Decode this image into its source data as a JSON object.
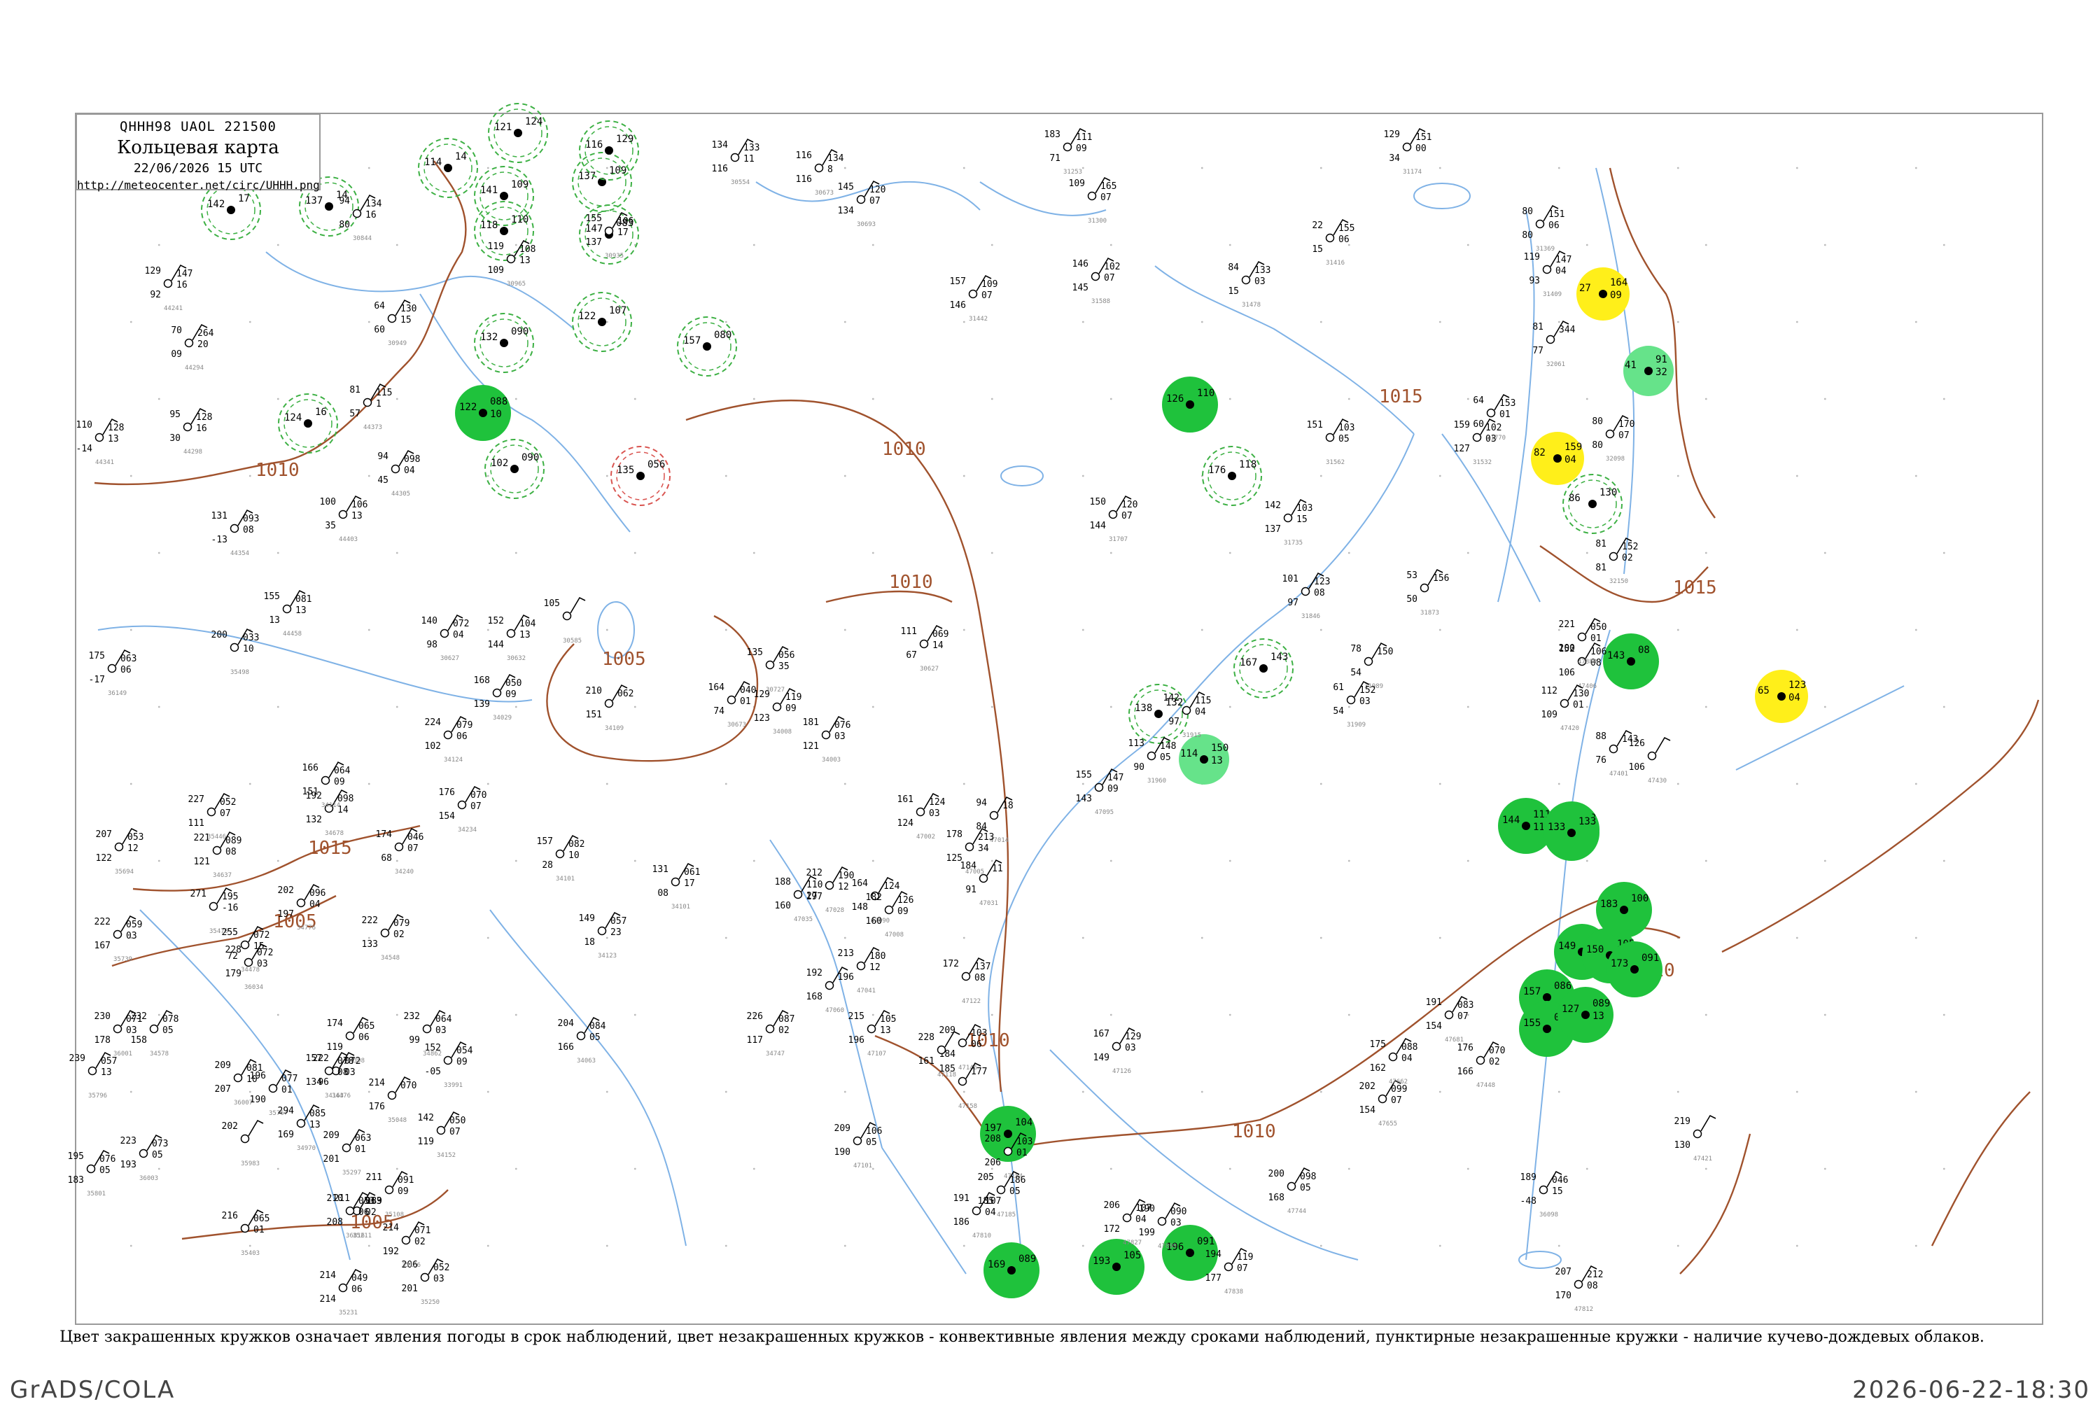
{
  "header": {
    "code": "QHHH98  UAOL  221500",
    "title": "Кольцевая карта",
    "date": "22/06/2026 15 UTC",
    "url": "http://meteocenter.net/circ/UHHH.png"
  },
  "caption": "Цвет закрашенных кружков означает явления погоды в срок наблюдений, цвет незакрашенных кружков - конвективные явления между сроками наблюдений, пунктирные незакрашенные кружки - наличие кучево-дождевых облаков.",
  "footer": {
    "left": "GrADS/COLA",
    "right": "2026-06-22-18:30"
  },
  "colors": {
    "frame": "#9a9a9a",
    "isobar": "#a0522d",
    "river": "#7fb2e6",
    "dashed_circle": "#3cb043",
    "green_fill": "#1fc23c",
    "light_green_fill": "#66e38a",
    "yellow_fill": "#ffef1a",
    "red_circle": "#d9534f"
  },
  "isobars": [
    {
      "label": "1010"
    },
    {
      "label": "1010"
    },
    {
      "label": "1005"
    },
    {
      "label": "1015"
    },
    {
      "label": "1005"
    },
    {
      "label": "1010"
    },
    {
      "label": "1005"
    },
    {
      "label": "1010"
    },
    {
      "label": "1010"
    },
    {
      "label": "1015"
    },
    {
      "label": "1015"
    },
    {
      "label": "1010"
    }
  ],
  "stations": [
    {
      "idx": "44241",
      "t": "129",
      "td": "92",
      "p": "147",
      "pt": "16"
    },
    {
      "idx": "44294",
      "t": "70",
      "td": "09",
      "p": "264",
      "pt": "20"
    },
    {
      "idx": "44298",
      "t": "95",
      "td": "30",
      "p": "128",
      "pt": "16"
    },
    {
      "idx": "44341",
      "t": "110",
      "td": "-14",
      "p": "128",
      "pt": "13"
    },
    {
      "idx": "44354",
      "t": "131",
      "td": "-13",
      "p": "093",
      "pt": "08"
    },
    {
      "idx": "44458",
      "t": "155",
      "td": "13",
      "p": "081",
      "pt": "13"
    },
    {
      "idx": "44403",
      "t": "100",
      "td": "35",
      "p": "106",
      "pt": "13"
    },
    {
      "idx": "44373",
      "t": "81",
      "td": "57",
      "p": "115",
      "pt": "1"
    },
    {
      "idx": "44305",
      "t": "94",
      "td": "45",
      "p": "098",
      "pt": "04"
    },
    {
      "idx": "30949",
      "t": "64",
      "td": "60",
      "p": "130",
      "pt": "15"
    },
    {
      "idx": "30844",
      "t": "94",
      "td": "80",
      "p": "134",
      "pt": "16"
    },
    {
      "idx": "30965",
      "t": "119",
      "td": "109",
      "p": "108",
      "pt": "13"
    },
    {
      "idx": "30935",
      "t": "155",
      "td": "137",
      "p": "106",
      "pt": "17"
    },
    {
      "idx": "30554",
      "t": "134",
      "td": "116",
      "p": "133",
      "pt": "11"
    },
    {
      "idx": "30673",
      "t": "116",
      "td": "116",
      "p": "134",
      "pt": "8"
    },
    {
      "idx": "30693",
      "t": "145",
      "td": "134",
      "p": "120",
      "pt": "07"
    },
    {
      "idx": "31253",
      "t": "183",
      "td": "71",
      "p": "111",
      "pt": "09"
    },
    {
      "idx": "31300",
      "t": "109",
      "td": "",
      "p": "165",
      "pt": "07"
    },
    {
      "idx": "31442",
      "t": "157",
      "td": "146",
      "p": "109",
      "pt": "07"
    },
    {
      "idx": "31588",
      "t": "146",
      "td": "145",
      "p": "102",
      "pt": "07"
    },
    {
      "idx": "31478",
      "t": "84",
      "td": "15",
      "p": "133",
      "pt": "03"
    },
    {
      "idx": "31416",
      "t": "22",
      "td": "15",
      "p": "155",
      "pt": "06"
    },
    {
      "idx": "31174",
      "t": "129",
      "td": "34",
      "p": "151",
      "pt": "00"
    },
    {
      "idx": "31409",
      "t": "119",
      "td": "93",
      "p": "147",
      "pt": "04"
    },
    {
      "idx": "31369",
      "t": "80",
      "td": "80",
      "p": "151",
      "pt": "06"
    },
    {
      "idx": "32061",
      "t": "81",
      "td": "77",
      "p": "344",
      "pt": ""
    },
    {
      "idx": "32098",
      "t": "80",
      "td": "80",
      "p": "170",
      "pt": "07"
    },
    {
      "idx": "31770",
      "t": "64",
      "td": "60",
      "p": "153",
      "pt": "01"
    },
    {
      "idx": "32150",
      "t": "81",
      "td": "81",
      "p": "152",
      "pt": "02"
    },
    {
      "idx": "31735",
      "t": "142",
      "td": "137",
      "p": "103",
      "pt": "15"
    },
    {
      "idx": "31873",
      "t": "53",
      "td": "50",
      "p": "156",
      "pt": ""
    },
    {
      "idx": "31707",
      "t": "150",
      "td": "144",
      "p": "120",
      "pt": "07"
    },
    {
      "idx": "31562",
      "t": "151",
      "td": "",
      "p": "103",
      "pt": "05"
    },
    {
      "idx": "31532",
      "t": "159",
      "td": "127",
      "p": "102",
      "pt": "03"
    },
    {
      "idx": "31846",
      "t": "101",
      "td": "97",
      "p": "123",
      "pt": "08"
    },
    {
      "idx": "31989",
      "t": "78",
      "td": "54",
      "p": "150",
      "pt": ""
    },
    {
      "idx": "31909",
      "t": "61",
      "td": "54",
      "p": "152",
      "pt": "03"
    },
    {
      "idx": "31915",
      "t": "142",
      "td": "97",
      "p": "115",
      "pt": "04"
    },
    {
      "idx": "31960",
      "t": "113",
      "td": "90",
      "p": "148",
      "pt": "05"
    },
    {
      "idx": "47095",
      "t": "155",
      "td": "143",
      "p": "147",
      "pt": "09"
    },
    {
      "idx": "47014",
      "t": "94",
      "td": "84",
      "p": "18",
      "pt": ""
    },
    {
      "idx": "47002",
      "t": "161",
      "td": "124",
      "p": "124",
      "pt": "03"
    },
    {
      "idx": "47005",
      "t": "178",
      "td": "125",
      "p": "213",
      "pt": "34"
    },
    {
      "idx": "47028",
      "t": "212",
      "td": "197",
      "p": "190",
      "pt": "12"
    },
    {
      "idx": "47035",
      "t": "188",
      "td": "160",
      "p": "110",
      "pt": "27"
    },
    {
      "idx": "47090",
      "t": "164",
      "td": "148",
      "p": "124",
      "pt": ""
    },
    {
      "idx": "47031",
      "t": "184",
      "td": "91",
      "p": "11",
      "pt": ""
    },
    {
      "idx": "47008",
      "t": "182",
      "td": "160",
      "p": "126",
      "pt": "09"
    },
    {
      "idx": "47041",
      "t": "213",
      "td": "196",
      "p": "180",
      "pt": "12"
    },
    {
      "idx": "47060",
      "t": "192",
      "td": "168",
      "p": "",
      "pt": ""
    },
    {
      "idx": "47122",
      "t": "172",
      "td": "",
      "p": "137",
      "pt": "08"
    },
    {
      "idx": "47107",
      "t": "215",
      "td": "196",
      "p": "105",
      "pt": "13"
    },
    {
      "idx": "47146",
      "t": "209",
      "td": "184",
      "p": "103",
      "pt": "06"
    },
    {
      "idx": "47118",
      "t": "228",
      "td": "161",
      "p": "",
      "pt": ""
    },
    {
      "idx": "47126",
      "t": "167",
      "td": "149",
      "p": "129",
      "pt": "03"
    },
    {
      "idx": "47101",
      "t": "209",
      "td": "190",
      "p": "106",
      "pt": "05"
    },
    {
      "idx": "47158",
      "t": "185",
      "td": "",
      "p": "177",
      "pt": ""
    },
    {
      "idx": "47184",
      "t": "208",
      "td": "206",
      "p": "103",
      "pt": "01"
    },
    {
      "idx": "47185",
      "t": "205",
      "td": "185",
      "p": "186",
      "pt": "05"
    },
    {
      "idx": "47810",
      "t": "191",
      "td": "186",
      "p": "107",
      "pt": "04"
    },
    {
      "idx": "47827",
      "t": "206",
      "td": "172",
      "p": "107",
      "pt": "04"
    },
    {
      "idx": "47899",
      "t": "190",
      "td": "199",
      "p": "090",
      "pt": "03"
    },
    {
      "idx": "47838",
      "t": "194",
      "td": "177",
      "p": "119",
      "pt": "07"
    },
    {
      "idx": "47744",
      "t": "200",
      "td": "168",
      "p": "098",
      "pt": "05"
    },
    {
      "idx": "47655",
      "t": "202",
      "td": "154",
      "p": "099",
      "pt": "07"
    },
    {
      "idx": "47662",
      "t": "175",
      "td": "162",
      "p": "088",
      "pt": "04"
    },
    {
      "idx": "47681",
      "t": "191",
      "td": "154",
      "p": "083",
      "pt": "07"
    },
    {
      "idx": "47448",
      "t": "176",
      "td": "166",
      "p": "070",
      "pt": "02"
    },
    {
      "idx": "47421",
      "t": "219",
      "td": "130",
      "p": "",
      "pt": ""
    },
    {
      "idx": "47406",
      "t": "152",
      "td": "106",
      "p": "106",
      "pt": "08"
    },
    {
      "idx": "47420",
      "t": "112",
      "td": "109",
      "p": "130",
      "pt": "01"
    },
    {
      "idx": "47430",
      "t": "126",
      "td": "106",
      "p": "",
      "pt": ""
    },
    {
      "idx": "47401",
      "t": "88",
      "td": "76",
      "p": "143",
      "pt": ""
    },
    {
      "idx": "47880",
      "t": "221",
      "td": "200",
      "p": "050",
      "pt": "01"
    },
    {
      "idx": "47812",
      "t": "207",
      "td": "170",
      "p": "212",
      "pt": "08"
    },
    {
      "idx": "36098",
      "t": "189",
      "td": "-48",
      "p": "046",
      "pt": "15"
    },
    {
      "idx": "36149",
      "t": "175",
      "td": "-17",
      "p": "063",
      "pt": "06"
    },
    {
      "idx": "35498",
      "t": "200",
      "td": "",
      "p": "033",
      "pt": "10"
    },
    {
      "idx": "35446",
      "t": "227",
      "td": "111",
      "p": "052",
      "pt": "07"
    },
    {
      "idx": "35694",
      "t": "207",
      "td": "122",
      "p": "053",
      "pt": "12"
    },
    {
      "idx": "35470",
      "t": "271",
      "td": "",
      "p": "195",
      "pt": "-16"
    },
    {
      "idx": "35739",
      "t": "222",
      "td": "167",
      "p": "059",
      "pt": "03"
    },
    {
      "idx": "36001",
      "t": "230",
      "td": "178",
      "p": "071",
      "pt": "03"
    },
    {
      "idx": "35796",
      "t": "239",
      "td": "",
      "p": "057",
      "pt": "13"
    },
    {
      "idx": "36034",
      "t": "228",
      "td": "179",
      "p": "072",
      "pt": "03"
    },
    {
      "idx": "36007",
      "t": "209",
      "td": "207",
      "p": "081",
      "pt": "10"
    },
    {
      "idx": "35767",
      "t": "196",
      "td": "190",
      "p": "077",
      "pt": "01"
    },
    {
      "idx": "35801",
      "t": "195",
      "td": "183",
      "p": "076",
      "pt": "05"
    },
    {
      "idx": "36003",
      "t": "223",
      "td": "193",
      "p": "073",
      "pt": "05"
    },
    {
      "idx": "35983",
      "t": "202",
      "td": "",
      "p": "",
      "pt": ""
    },
    {
      "idx": "35297",
      "t": "209",
      "td": "201",
      "p": "063",
      "pt": "01"
    },
    {
      "idx": "35403",
      "t": "216",
      "td": "",
      "p": "065",
      "pt": "01"
    },
    {
      "idx": "35211",
      "t": "211",
      "td": "",
      "p": "063",
      "pt": "02"
    },
    {
      "idx": "36816",
      "t": "210",
      "td": "208",
      "p": "053",
      "pt": "06"
    },
    {
      "idx": "35231",
      "t": "214",
      "td": "214",
      "p": "049",
      "pt": "06"
    },
    {
      "idx": "35250",
      "t": "206",
      "td": "201",
      "p": "052",
      "pt": "03"
    },
    {
      "idx": "35186",
      "t": "214",
      "td": "192",
      "p": "071",
      "pt": "02"
    },
    {
      "idx": "35108",
      "t": "211",
      "td": "189",
      "p": "091",
      "pt": "09"
    },
    {
      "idx": "35048",
      "t": "214",
      "td": "176",
      "p": "070",
      "pt": ""
    },
    {
      "idx": "34970",
      "t": "294",
      "td": "169",
      "p": "085",
      "pt": "13"
    },
    {
      "idx": "34862",
      "t": "232",
      "td": "99",
      "p": "064",
      "pt": "03"
    },
    {
      "idx": "34747",
      "t": "226",
      "td": "117",
      "p": "087",
      "pt": "02"
    },
    {
      "idx": "34678",
      "t": "192",
      "td": "132",
      "p": "098",
      "pt": "14"
    },
    {
      "idx": "34637",
      "t": "221",
      "td": "121",
      "p": "089",
      "pt": "08"
    },
    {
      "idx": "34776",
      "t": "202",
      "td": "197",
      "p": "096",
      "pt": "04"
    },
    {
      "idx": "34548",
      "t": "222",
      "td": "133",
      "p": "079",
      "pt": "02"
    },
    {
      "idx": "34478",
      "t": "255",
      "td": "72",
      "p": "072",
      "pt": "15"
    },
    {
      "idx": "34578",
      "t": "232",
      "td": "158",
      "p": "078",
      "pt": "05"
    },
    {
      "idx": "34476",
      "t": "222",
      "td": "96",
      "p": "072",
      "pt": "03"
    },
    {
      "idx": "34398",
      "t": "174",
      "td": "119",
      "p": "065",
      "pt": "06"
    },
    {
      "idx": "34163",
      "t": "157",
      "td": "134",
      "p": "078",
      "pt": "08"
    },
    {
      "idx": "34152",
      "t": "142",
      "td": "119",
      "p": "050",
      "pt": "07"
    },
    {
      "idx": "33991",
      "t": "152",
      "td": "-05",
      "p": "054",
      "pt": "09"
    },
    {
      "idx": "34240",
      "t": "174",
      "td": "68",
      "p": "046",
      "pt": "07"
    },
    {
      "idx": "34234",
      "t": "176",
      "td": "154",
      "p": "070",
      "pt": "07"
    },
    {
      "idx": "34114",
      "t": "166",
      "td": "151",
      "p": "064",
      "pt": "09"
    },
    {
      "idx": "34124",
      "t": "224",
      "td": "102",
      "p": "079",
      "pt": "06"
    },
    {
      "idx": "34029",
      "t": "168",
      "td": "139",
      "p": "050",
      "pt": "09"
    },
    {
      "idx": "34109",
      "t": "210",
      "td": "151",
      "p": "062",
      "pt": ""
    },
    {
      "idx": "34101",
      "t": "131",
      "td": "08",
      "p": "061",
      "pt": "17"
    },
    {
      "idx": "34123",
      "t": "149",
      "td": "18",
      "p": "057",
      "pt": "23"
    },
    {
      "idx": "34101b",
      "t": "157",
      "td": "28",
      "p": "082",
      "pt": "10"
    },
    {
      "idx": "34063",
      "t": "204",
      "td": "166",
      "p": "084",
      "pt": "05"
    },
    {
      "idx": "34003",
      "t": "181",
      "td": "121",
      "p": "076",
      "pt": "03"
    },
    {
      "idx": "34008",
      "t": "129",
      "td": "123",
      "p": "119",
      "pt": "09"
    },
    {
      "idx": "30627",
      "t": "111",
      "td": "67",
      "p": "069",
      "pt": "14"
    },
    {
      "idx": "30727",
      "t": "135",
      "td": "",
      "p": "056",
      "pt": "35"
    },
    {
      "idx": "30673b",
      "t": "164",
      "td": "74",
      "p": "040",
      "pt": "01"
    },
    {
      "idx": "30627b",
      "t": "140",
      "td": "98",
      "p": "072",
      "pt": "04"
    },
    {
      "idx": "30632",
      "t": "152",
      "td": "144",
      "p": "104",
      "pt": "13"
    },
    {
      "idx": "30585",
      "t": "105",
      "td": "",
      "p": "",
      "pt": ""
    }
  ],
  "phenomena": [
    {
      "kind": "green_fill",
      "vals": [
        "122",
        "088",
        "10"
      ]
    },
    {
      "kind": "green_fill",
      "vals": [
        "143",
        "08"
      ]
    },
    {
      "kind": "green_fill",
      "vals": [
        "144",
        "111",
        "11"
      ]
    },
    {
      "kind": "green_fill",
      "vals": [
        "156",
        "123",
        "14"
      ]
    },
    {
      "kind": "green_fill",
      "vals": [
        "133",
        "133"
      ]
    },
    {
      "kind": "green_fill",
      "vals": [
        "149",
        "103",
        "10"
      ]
    },
    {
      "kind": "green_fill",
      "vals": [
        "150",
        "105",
        "11"
      ]
    },
    {
      "kind": "green_fill",
      "vals": [
        "157",
        "086"
      ]
    },
    {
      "kind": "green_fill",
      "vals": [
        "155",
        "084"
      ]
    },
    {
      "kind": "green_fill",
      "vals": [
        "127",
        "089",
        "13"
      ]
    },
    {
      "kind": "green_fill",
      "vals": [
        "173",
        "091"
      ]
    },
    {
      "kind": "green_fill",
      "vals": [
        "183",
        "100"
      ]
    },
    {
      "kind": "green_fill",
      "vals": [
        "193",
        "105"
      ]
    },
    {
      "kind": "green_fill",
      "vals": [
        "197",
        "104"
      ]
    },
    {
      "kind": "green_fill",
      "vals": [
        "169",
        "089"
      ]
    },
    {
      "kind": "green_fill",
      "vals": [
        "196",
        "091"
      ]
    },
    {
      "kind": "light_green_fill",
      "vals": [
        "114",
        "150",
        "13"
      ]
    },
    {
      "kind": "light_green_fill",
      "vals": [
        "41",
        "91",
        "32"
      ]
    },
    {
      "kind": "yellow_fill",
      "vals": [
        "27",
        "164",
        "09"
      ]
    },
    {
      "kind": "yellow_fill",
      "vals": [
        "82",
        "159",
        "04"
      ]
    },
    {
      "kind": "yellow_fill",
      "vals": [
        "65",
        "123",
        "04"
      ]
    },
    {
      "kind": "dashed_circle",
      "vals": [
        "137",
        "14"
      ]
    },
    {
      "kind": "dashed_circle",
      "vals": [
        "142",
        "17"
      ]
    },
    {
      "kind": "dashed_circle",
      "vals": [
        "124",
        "16"
      ]
    },
    {
      "kind": "dashed_circle",
      "vals": [
        "121",
        "124"
      ]
    },
    {
      "kind": "dashed_circle",
      "vals": [
        "114",
        "14"
      ]
    },
    {
      "kind": "dashed_circle",
      "vals": [
        "141",
        "109"
      ]
    },
    {
      "kind": "dashed_circle",
      "vals": [
        "137",
        "109"
      ]
    },
    {
      "kind": "dashed_circle",
      "vals": [
        "116",
        "129"
      ]
    },
    {
      "kind": "dashed_circle",
      "vals": [
        "118",
        "110"
      ]
    },
    {
      "kind": "dashed_circle",
      "vals": [
        "147",
        "083"
      ]
    },
    {
      "kind": "dashed_circle",
      "vals": [
        "122",
        "107"
      ]
    },
    {
      "kind": "dashed_circle",
      "vals": [
        "157",
        "080"
      ]
    },
    {
      "kind": "dashed_circle",
      "vals": [
        "132",
        "090"
      ]
    },
    {
      "kind": "dashed_circle",
      "vals": [
        "102",
        "090"
      ]
    },
    {
      "kind": "dashed_circle",
      "vals": [
        "176",
        "118"
      ]
    },
    {
      "kind": "dashed_circle",
      "vals": [
        "138",
        "132"
      ]
    },
    {
      "kind": "dashed_circle",
      "vals": [
        "167",
        "143"
      ]
    },
    {
      "kind": "dashed_circle",
      "vals": [
        "86",
        "130"
      ]
    },
    {
      "kind": "green_fill",
      "vals": [
        "126",
        "110"
      ]
    },
    {
      "kind": "red_circle",
      "vals": [
        "135",
        "056"
      ]
    }
  ]
}
